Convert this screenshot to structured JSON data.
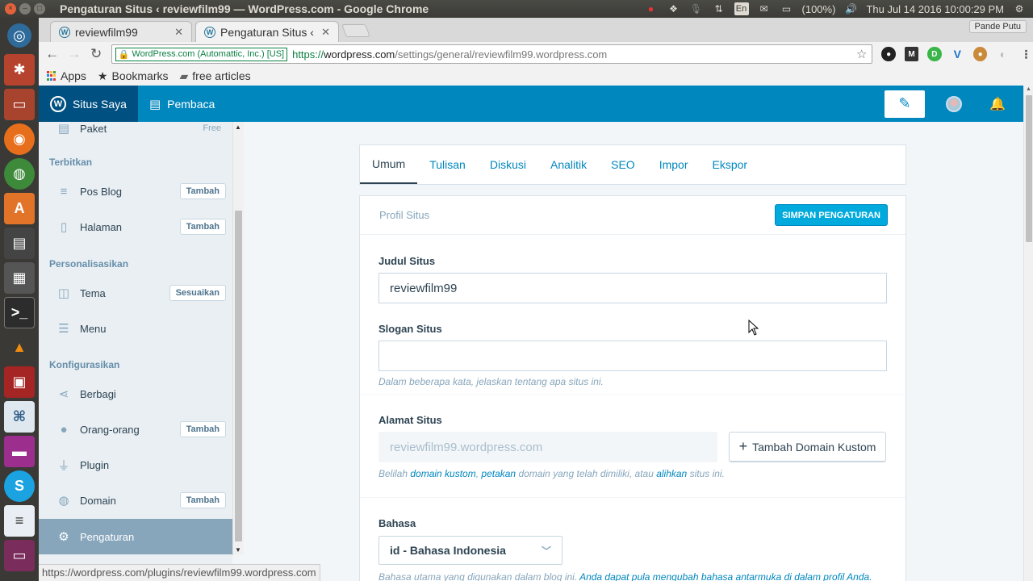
{
  "os": {
    "window_title": "Pengaturan Situs ‹ reviewfilm99 — WordPress.com - Google Chrome",
    "keyboard": "En",
    "battery": "(100%)",
    "clock": "Thu Jul 14 2016 10:00:29 PM"
  },
  "browser": {
    "tabs": [
      {
        "label": "reviewfilm99"
      },
      {
        "label": "Pengaturan Situs ‹ "
      }
    ],
    "profile": "Pande Putu",
    "ev_label": "WordPress.com (Automattic, Inc.) [US]",
    "url_scheme": "https://",
    "url_host": "wordpress.com",
    "url_path": "/settings/general/reviewfilm99.wordpress.com",
    "bookmarks": {
      "apps": "Apps",
      "bookmarks": "Bookmarks",
      "folder": "free articles"
    },
    "status_url": "https://wordpress.com/plugins/reviewfilm99.wordpress.com"
  },
  "masterbar": {
    "my_site": "Situs Saya",
    "reader": "Pembaca"
  },
  "sidebar": {
    "plan": {
      "label": "Paket",
      "badge": "Free"
    },
    "sections": {
      "publish": "Terbitkan",
      "personalize": "Personalisasikan",
      "configure": "Konfigurasikan"
    },
    "items": {
      "posts": {
        "label": "Pos Blog",
        "action": "Tambah"
      },
      "pages": {
        "label": "Halaman",
        "action": "Tambah"
      },
      "themes": {
        "label": "Tema",
        "action": "Sesuaikan"
      },
      "menus": {
        "label": "Menu"
      },
      "sharing": {
        "label": "Berbagi"
      },
      "people": {
        "label": "Orang-orang",
        "action": "Tambah"
      },
      "plugins": {
        "label": "Plugin"
      },
      "domains": {
        "label": "Domain",
        "action": "Tambah"
      },
      "settings": {
        "label": "Pengaturan"
      }
    }
  },
  "settings": {
    "tabs": [
      "Umum",
      "Tulisan",
      "Diskusi",
      "Analitik",
      "SEO",
      "Impor",
      "Ekspor"
    ],
    "panel_title": "Profil Situs",
    "save_button": "SIMPAN PENGATURAN",
    "site_title_label": "Judul Situs",
    "site_title_value": "reviewfilm99",
    "tagline_label": "Slogan Situs",
    "tagline_value": "",
    "tagline_help": "Dalam beberapa kata, jelaskan tentang apa situs ini.",
    "address_label": "Alamat Situs",
    "address_value": "reviewfilm99.wordpress.com",
    "add_domain_button": "Tambah Domain Kustom",
    "address_help": {
      "p1": "Belilah ",
      "link1": "domain kustom",
      "p2": ", ",
      "link2": "petakan",
      "p3": " domain yang telah dimiliki, atau ",
      "link3": "alihkan",
      "p4": " situs ini."
    },
    "language_label": "Bahasa",
    "language_value": "id - Bahasa Indonesia",
    "language_help": "Bahasa utama yang digunakan dalam blog ini.",
    "language_help_link": "Anda dapat pula mengubah bahasa antarmuka di dalam profil Anda."
  },
  "colors": {
    "masterbar": "#0087be",
    "accent": "#00aadc",
    "sidebar_bg": "#e9eff3",
    "selected": "#87a6bc"
  }
}
